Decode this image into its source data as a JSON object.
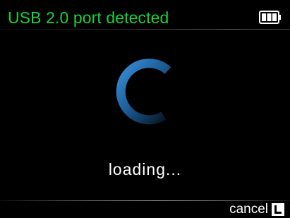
{
  "header": {
    "title": "USB 2.0 port detected",
    "battery_icon": "battery-icon",
    "battery_level": 1.0,
    "title_color": "#17d23a"
  },
  "main": {
    "spinner_icon": "loading-spinner-icon",
    "status_text": "loading..."
  },
  "footer": {
    "cancel_label": "cancel",
    "cancel_key_icon": "l-button-icon"
  }
}
